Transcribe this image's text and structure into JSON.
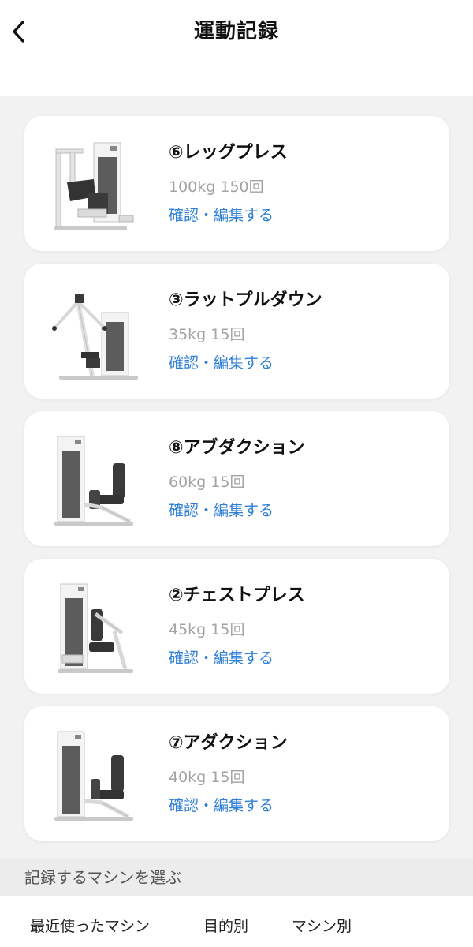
{
  "header": {
    "title": "運動記録",
    "back_icon": "chevron-left-icon"
  },
  "records": [
    {
      "name": "⑥レッグプレス",
      "detail": "100kg 150回",
      "link": "確認・編集する",
      "icon": "leg-press-machine"
    },
    {
      "name": "③ラットプルダウン",
      "detail": "35kg 15回",
      "link": "確認・編集する",
      "icon": "lat-pulldown-machine"
    },
    {
      "name": "⑧アブダクション",
      "detail": "60kg 15回",
      "link": "確認・編集する",
      "icon": "abduction-machine"
    },
    {
      "name": "②チェストプレス",
      "detail": "45kg 15回",
      "link": "確認・編集する",
      "icon": "chest-press-machine"
    },
    {
      "name": "⑦アダクション",
      "detail": "40kg 15回",
      "link": "確認・編集する",
      "icon": "adduction-machine"
    }
  ],
  "machine_select": {
    "label": "記録するマシンを選ぶ",
    "tabs": [
      "最近使ったマシン",
      "目的別",
      "マシン別"
    ]
  },
  "colors": {
    "link": "#2f7fd8",
    "muted_text": "#a3a3a3",
    "background": "#f2f2f2"
  }
}
